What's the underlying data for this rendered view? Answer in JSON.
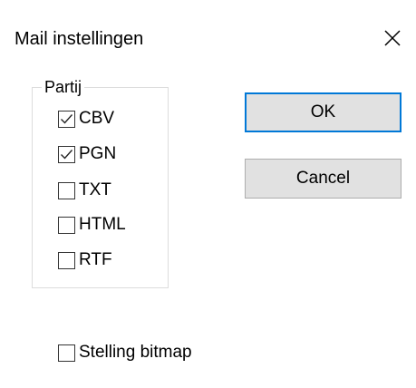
{
  "window": {
    "title": "Mail instellingen",
    "close_icon": "close-icon"
  },
  "group": {
    "legend": "Partij",
    "options": [
      {
        "label": "CBV",
        "checked": true
      },
      {
        "label": "PGN",
        "checked": true
      },
      {
        "label": "TXT",
        "checked": false
      },
      {
        "label": "HTML",
        "checked": false
      },
      {
        "label": "RTF",
        "checked": false
      }
    ]
  },
  "bitmap_option": {
    "label": "Stelling bitmap",
    "checked": false
  },
  "buttons": {
    "ok_label": "OK",
    "cancel_label": "Cancel"
  },
  "colors": {
    "focus_border": "#0078d7",
    "button_face": "#e1e1e1"
  }
}
